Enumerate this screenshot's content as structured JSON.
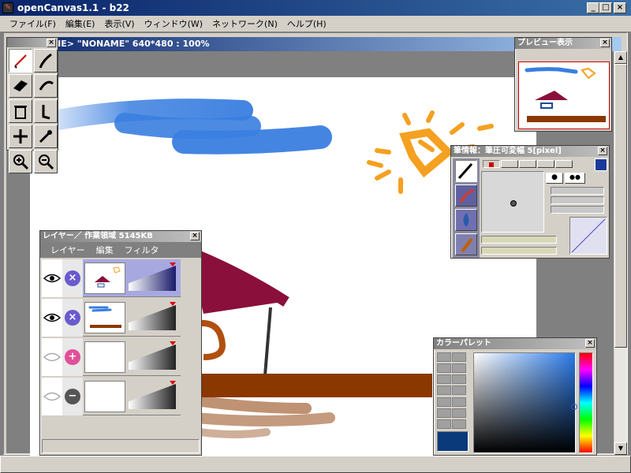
{
  "app": {
    "title": "openCanvas1.1 - b22",
    "icon_glyph": "✎",
    "window_controls": [
      "_",
      "□",
      "×"
    ]
  },
  "menu": [
    "ファイル(F)",
    "編集(E)",
    "表示(V)",
    "ウィンドウ(W)",
    "ネットワーク(N)",
    "ヘルプ(H)"
  ],
  "document": {
    "title": "NE> \"NONAME\" 640*480 : 100%",
    "scroll_up": "▲",
    "scroll_down": "▼"
  },
  "tools": {
    "items": [
      "pen-icon",
      "brush-icon",
      "eraser-icon",
      "trash-icon",
      "wand-icon",
      "move-icon",
      "dropper-icon",
      "zoom-in-icon",
      "zoom-out-icon"
    ],
    "close": "×"
  },
  "layers": {
    "title": "レイヤー／ 作業領域 5145KB",
    "close": "×",
    "menu": [
      "レイヤー",
      "編集",
      "フィルタ"
    ],
    "rows": [
      {
        "mode": "×",
        "mode_color": "#6a5acd"
      },
      {
        "mode": "×",
        "mode_color": "#6a5acd"
      },
      {
        "mode": "+",
        "mode_color": "#e0509a"
      },
      {
        "mode": "−",
        "mode_color": "#555555"
      }
    ]
  },
  "preview": {
    "title": "プレビュー表示",
    "close": "×"
  },
  "brush": {
    "title": "筆情報：筆圧可変幅 5[pixel]",
    "close": "×"
  },
  "colors": {
    "title": "カラーパレット",
    "close": "×",
    "current": "#0a3a7a"
  }
}
